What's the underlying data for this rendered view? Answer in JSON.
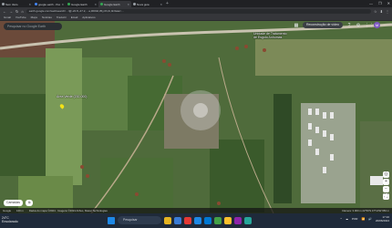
{
  "browser": {
    "tabs": [
      {
        "title": "Sem título",
        "color": "#9aa0a6"
      },
      {
        "title": "google earth - Pesquisa",
        "color": "#4285f4"
      },
      {
        "title": "Google Earth",
        "color": "#34a853"
      },
      {
        "title": "Google Earth",
        "color": "#34a853",
        "active": true
      },
      {
        "title": "Nova guia",
        "color": "#9aa0a6"
      }
    ],
    "new_tab": "+",
    "window_controls": [
      "—",
      "❐",
      "✕"
    ],
    "address": "earth.google.com/web/search/…/@-22.8,-47.2,…a,3000d,35y,0h,0t,0r/data=…",
    "nav": [
      "←",
      "→",
      "↻",
      "⌂"
    ],
    "extensions": [
      "☆",
      "⬇",
      "⋮"
    ],
    "bookmarks": [
      "Gmail",
      "YouTube",
      "Maps",
      "Notícias",
      "Traduzir",
      "Email",
      "Aplicativos"
    ]
  },
  "earth": {
    "search_placeholder": "Pesquisar no Google Earth",
    "toolbar": {
      "grid_icon": "apps-icon",
      "measure_label": "Reconstrução de vídeo",
      "help": "?",
      "settings": "⚙",
      "apps": "⋮⋮",
      "avatar": "M"
    },
    "labels": [
      {
        "text": "Unidade de Tratamento",
        "key": "label1"
      },
      {
        "text": "de Esgoto Anhumas",
        "key": "label2"
      },
      {
        "text": "Área Verde (200.000)",
        "key": "pin_label"
      }
    ],
    "bottom_left": [
      "Camadas",
      "⧉"
    ],
    "right_controls": [
      "◎",
      "+",
      "−",
      "⛶"
    ],
    "status": {
      "left": "Google",
      "scale": "100 m",
      "attribution": "Dados do mapa ©2024 · Imagens ©2024 Airbus, Maxar Technologies",
      "camera": "Câmera: 3.000 m   22°50'S 47°10'W   650 m"
    }
  },
  "taskbar": {
    "weather_temp": "24°C",
    "weather_desc": "Ensolarado",
    "search": "Pesquisar",
    "apps": [
      "#e6b422",
      "#3a7bd5",
      "#e53935",
      "#1e88e5",
      "#0078d4",
      "#43a047",
      "#fbc02d",
      "#8e24aa",
      "#26a69a"
    ],
    "tray": [
      "^",
      "☁",
      "POR",
      "📶",
      "🔊"
    ],
    "time": "17:10",
    "date": "20/06/2024"
  }
}
